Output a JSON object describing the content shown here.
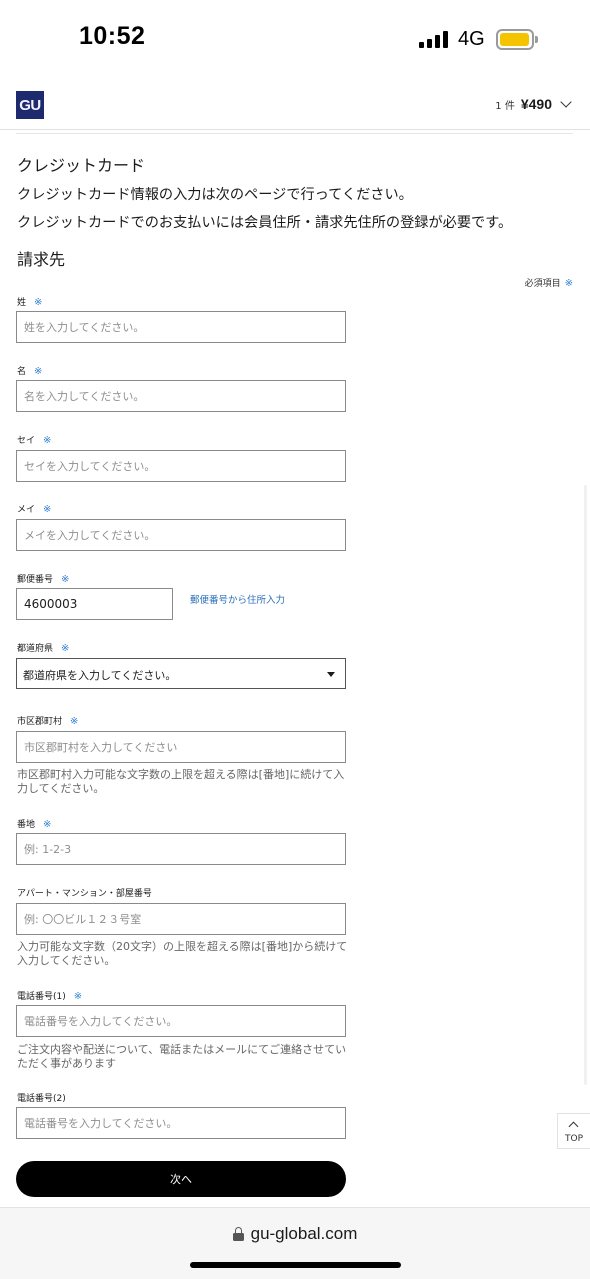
{
  "status_bar": {
    "time": "10:52",
    "network": "4G",
    "battery_level": 0.95,
    "battery_color": "#f5c400"
  },
  "header": {
    "logo": "GU",
    "logo_color": "#1d2a6e",
    "cart_count": "1 件",
    "cart_total": "¥490"
  },
  "payment": {
    "title": "クレジットカード",
    "info1": "クレジットカード情報の入力は次のページで行ってください。",
    "info2": "クレジットカードでのお支払いには会員住所・請求先住所の登録が必要です。"
  },
  "billing": {
    "title": "請求先",
    "required_label": "必須項目",
    "required_mark": "※",
    "accent_color": "#2f7fd6"
  },
  "fields": {
    "last_name": {
      "label": "姓",
      "placeholder": "姓を入力してください。",
      "value": ""
    },
    "first_name": {
      "label": "名",
      "placeholder": "名を入力してください。",
      "value": ""
    },
    "last_kana": {
      "label": "セイ",
      "placeholder": "セイを入力してください。",
      "value": ""
    },
    "first_kana": {
      "label": "メイ",
      "placeholder": "メイを入力してください。",
      "value": ""
    },
    "postal": {
      "label": "郵便番号",
      "value": "4600003",
      "link": "郵便番号から住所入力"
    },
    "prefecture": {
      "label": "都道府県",
      "selected": "都道府県を入力してください。"
    },
    "city": {
      "label": "市区郡町村",
      "placeholder": "市区郡町村を入力してください",
      "help": "市区郡町村入力可能な文字数の上限を超える際は[番地]に続けて入力してください。"
    },
    "street": {
      "label": "番地",
      "placeholder": "例: 1-2-3"
    },
    "building": {
      "label": "アパート・マンション・部屋番号",
      "placeholder": "例: 〇〇ビル１２３号室",
      "help": "入力可能な文字数（20文字）の上限を超える際は[番地]から続けて入力してください。"
    },
    "phone1": {
      "label": "電話番号(1)",
      "placeholder": "電話番号を入力してください。",
      "help": "ご注文内容や配送について、電話またはメールにてご連絡させていただく事があります"
    },
    "phone2": {
      "label": "電話番号(2)",
      "placeholder": "電話番号を入力してください。"
    }
  },
  "actions": {
    "next": "次へ",
    "top": "TOP"
  },
  "browser": {
    "url": "gu-global.com"
  }
}
